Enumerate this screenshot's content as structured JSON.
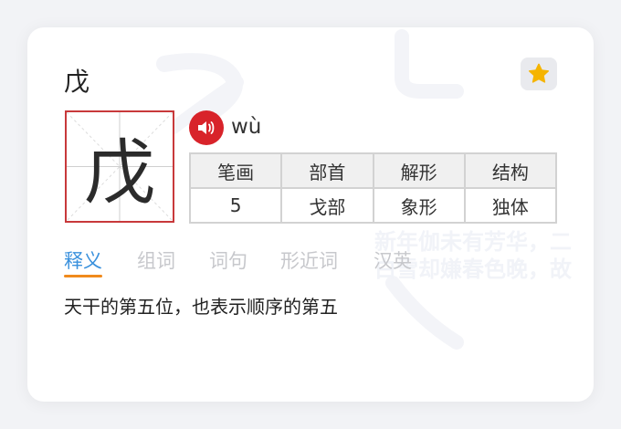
{
  "entry": {
    "character": "戊",
    "pinyin": "wù",
    "favorite_icon": "star-icon",
    "audio_icon": "speaker-icon"
  },
  "table": {
    "headers": [
      "笔画",
      "部首",
      "解形",
      "结构"
    ],
    "values": [
      "5",
      "戈部",
      "象形",
      "独体"
    ]
  },
  "tabs": [
    {
      "label": "释义",
      "active": true
    },
    {
      "label": "组词",
      "active": false
    },
    {
      "label": "词句",
      "active": false
    },
    {
      "label": "形近词",
      "active": false
    },
    {
      "label": "汉英",
      "active": false
    }
  ],
  "definition": "天干的第五位，也表示顺序的第五",
  "watermark": {
    "lines": [
      "新年伽未有芳华，二",
      "白雪却嫌春色晚，故"
    ]
  },
  "colors": {
    "accent_blue": "#3a91dd",
    "tab_underline": "#f08a1c",
    "grid_red": "#c8393b",
    "speaker_red": "#d8232a",
    "star_gold": "#f5b400"
  }
}
